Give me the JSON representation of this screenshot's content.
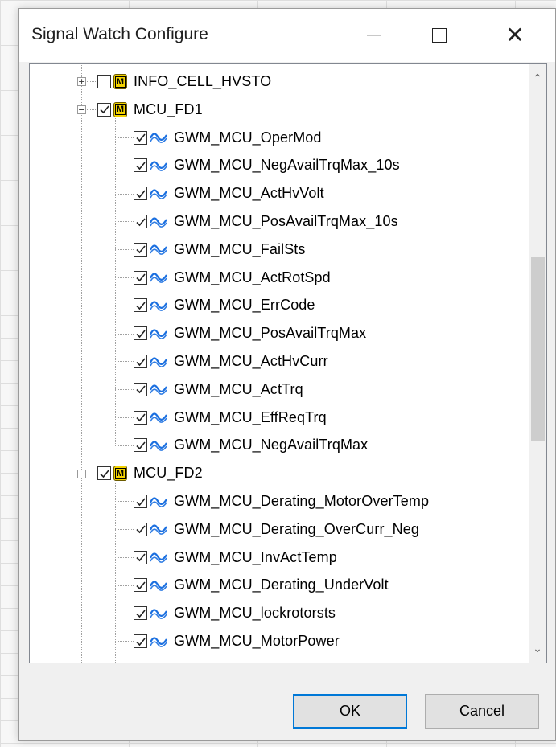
{
  "window": {
    "title": "Signal Watch Configure",
    "min_symbol": "—",
    "close_symbol": "✕"
  },
  "tree": {
    "nodes": [
      {
        "type": "group",
        "label": "INFO_CELL_HVSTO",
        "checked": false,
        "expanded": false
      },
      {
        "type": "group",
        "label": "MCU_FD1",
        "checked": true,
        "expanded": true
      },
      {
        "type": "signal",
        "label": "GWM_MCU_OperMod",
        "checked": true
      },
      {
        "type": "signal",
        "label": "GWM_MCU_NegAvailTrqMax_10s",
        "checked": true
      },
      {
        "type": "signal",
        "label": "GWM_MCU_ActHvVolt",
        "checked": true
      },
      {
        "type": "signal",
        "label": "GWM_MCU_PosAvailTrqMax_10s",
        "checked": true
      },
      {
        "type": "signal",
        "label": "GWM_MCU_FailSts",
        "checked": true
      },
      {
        "type": "signal",
        "label": "GWM_MCU_ActRotSpd",
        "checked": true
      },
      {
        "type": "signal",
        "label": "GWM_MCU_ErrCode",
        "checked": true
      },
      {
        "type": "signal",
        "label": "GWM_MCU_PosAvailTrqMax",
        "checked": true
      },
      {
        "type": "signal",
        "label": "GWM_MCU_ActHvCurr",
        "checked": true
      },
      {
        "type": "signal",
        "label": "GWM_MCU_ActTrq",
        "checked": true
      },
      {
        "type": "signal",
        "label": "GWM_MCU_EffReqTrq",
        "checked": true
      },
      {
        "type": "signal",
        "label": "GWM_MCU_NegAvailTrqMax",
        "checked": true
      },
      {
        "type": "group",
        "label": "MCU_FD2",
        "checked": true,
        "expanded": true
      },
      {
        "type": "signal",
        "label": "GWM_MCU_Derating_MotorOverTemp",
        "checked": true
      },
      {
        "type": "signal",
        "label": "GWM_MCU_Derating_OverCurr_Neg",
        "checked": true
      },
      {
        "type": "signal",
        "label": "GWM_MCU_InvActTemp",
        "checked": true
      },
      {
        "type": "signal",
        "label": "GWM_MCU_Derating_UnderVolt",
        "checked": true
      },
      {
        "type": "signal",
        "label": "GWM_MCU_lockrotorsts",
        "checked": true
      },
      {
        "type": "signal",
        "label": "GWM_MCU_MotorPower",
        "checked": true
      }
    ],
    "group_icon_letter": "M",
    "scroll_up_symbol": "⌃",
    "scroll_down_symbol": "⌄",
    "scroll_position": 0.46,
    "colors": {
      "wave": "#1a6fe0",
      "group_icon": "#f2d200",
      "ok_border": "#0078d7"
    }
  },
  "buttons": {
    "ok_label": "OK",
    "cancel_label": "Cancel"
  }
}
